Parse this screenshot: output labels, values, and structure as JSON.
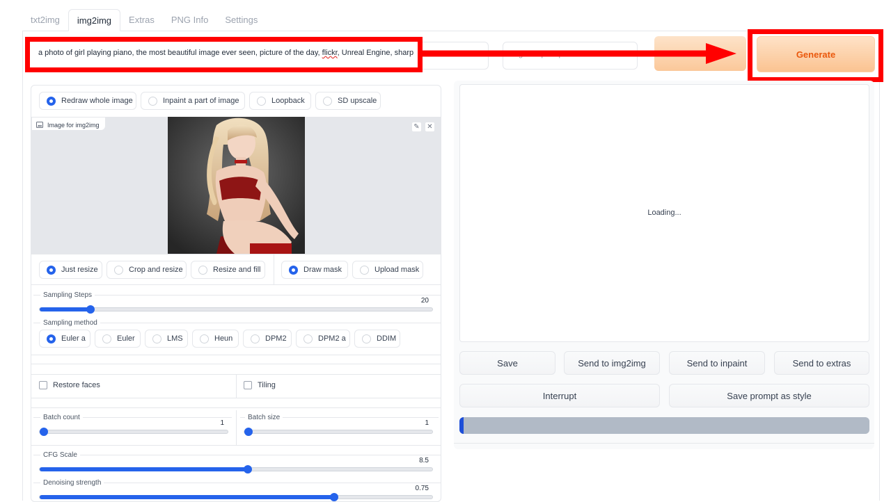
{
  "tabs": [
    "txt2img",
    "img2img",
    "Extras",
    "PNG Info",
    "Settings"
  ],
  "active_tab": "img2img",
  "prompt": {
    "text_before": "a photo of girl playing piano, the most beautiful image ever seen, picture of the day, ",
    "text_flagged": "flickr",
    "text_after": ", Unreal Engine, sharp"
  },
  "negative_prompt": {
    "placeholder": "Negative prompt"
  },
  "generate_label": "Generate",
  "mode_options": [
    "Redraw whole image",
    "Inpaint a part of image",
    "Loopback",
    "SD upscale"
  ],
  "mode_selected": "Redraw whole image",
  "image_input": {
    "label": "Image for img2img",
    "edit_icon": "pencil-icon",
    "clear_icon": "close-icon"
  },
  "resize_options": [
    "Just resize",
    "Crop and resize",
    "Resize and fill"
  ],
  "resize_selected": "Just resize",
  "mask_options": [
    "Draw mask",
    "Upload mask"
  ],
  "mask_selected": "Draw mask",
  "sampling_steps": {
    "label": "Sampling Steps",
    "value": "20",
    "fraction": 0.13
  },
  "sampling_method": {
    "label": "Sampling method",
    "options": [
      "Euler a",
      "Euler",
      "LMS",
      "Heun",
      "DPM2",
      "DPM2 a",
      "DDIM"
    ],
    "selected": "Euler a"
  },
  "restore_faces_label": "Restore faces",
  "tiling_label": "Tiling",
  "batch_count": {
    "label": "Batch count",
    "value": "1",
    "fraction": 0.0
  },
  "batch_size": {
    "label": "Batch size",
    "value": "1",
    "fraction": 0.0
  },
  "cfg_scale": {
    "label": "CFG Scale",
    "value": "8.5",
    "fraction": 0.53
  },
  "denoising_strength": {
    "label": "Denoising strength",
    "value": "0.75",
    "fraction": 0.75
  },
  "output": {
    "loading_text": "Loading...",
    "save_label": "Save",
    "send_img2img_label": "Send to img2img",
    "send_inpaint_label": "Send to inpaint",
    "send_extras_label": "Send to extras",
    "interrupt_label": "Interrupt",
    "save_style_label": "Save prompt as style",
    "progress_fraction": 0.01
  },
  "colors": {
    "accent": "#2563eb",
    "generate_text": "#ea580c",
    "annotation_red": "#ff0000"
  }
}
